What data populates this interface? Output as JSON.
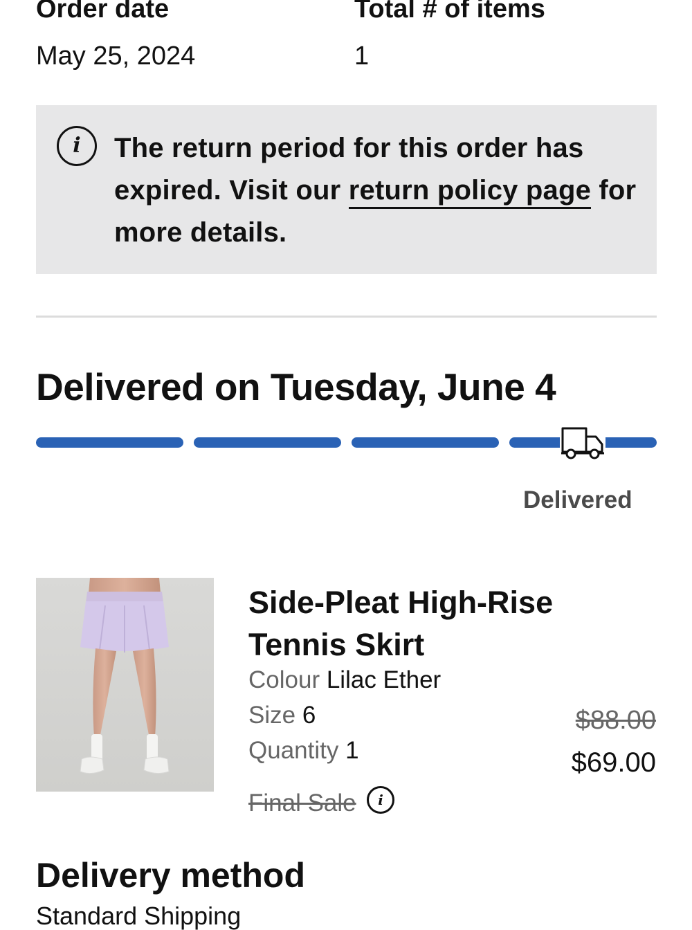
{
  "summary": {
    "order_date_label": "Order date",
    "order_date_value": "May 25, 2024",
    "total_items_label": "Total # of items",
    "total_items_value": "1"
  },
  "notice": {
    "icon": "info-icon",
    "text_before": "The return period for this order has expired. Visit our ",
    "link_text": "return policy page",
    "text_after": " for more details."
  },
  "delivery": {
    "title": "Delivered on Tuesday, June 4",
    "status_label": "Delivered",
    "progress_steps_completed": 4,
    "progress_steps_total": 4,
    "status_icon": "truck-icon",
    "progress_color": "#2a62b5"
  },
  "product": {
    "name": "Side-Pleat High-Rise Tennis Skirt",
    "colour_label": "Colour",
    "colour_value": "Lilac Ether",
    "size_label": "Size",
    "size_value": "6",
    "quantity_label": "Quantity",
    "quantity_value": "1",
    "final_sale_label": "Final Sale",
    "final_sale_icon": "info-icon",
    "original_price": "$88.00",
    "sale_price": "$69.00"
  },
  "delivery_method": {
    "title": "Delivery method",
    "value": "Standard Shipping"
  }
}
